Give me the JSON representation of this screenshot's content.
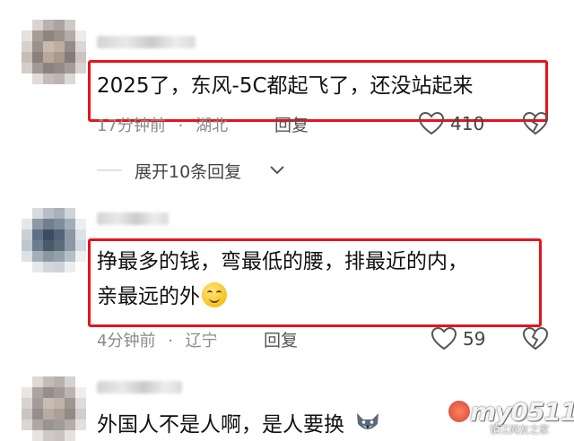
{
  "comments": [
    {
      "text": "2025了，东风-5C都起飞了，还没站起来",
      "time": "17分钟前",
      "location": "湖北",
      "reply_label": "回复",
      "likes": "410"
    },
    {
      "text_line1": "挣最多的钱，弯最低的腰，排最近的内，",
      "text_line2": "亲最远的外",
      "time": "4分钟前",
      "location": "辽宁",
      "reply_label": "回复",
      "likes": "59"
    },
    {
      "text": "外国人不是人啊，是人要换"
    }
  ],
  "meta_separator": "·",
  "expand_replies": "展开10条回复",
  "watermark": {
    "main": "my0511",
    "sub": "镇江网友之家"
  },
  "colors": {
    "highlight": "#e5141b",
    "meta": "#8a8a8a"
  },
  "icons": [
    "heart-icon",
    "broken-heart-icon",
    "chevron-down-icon",
    "smile-emoji-icon",
    "wolf-emoji-icon"
  ]
}
